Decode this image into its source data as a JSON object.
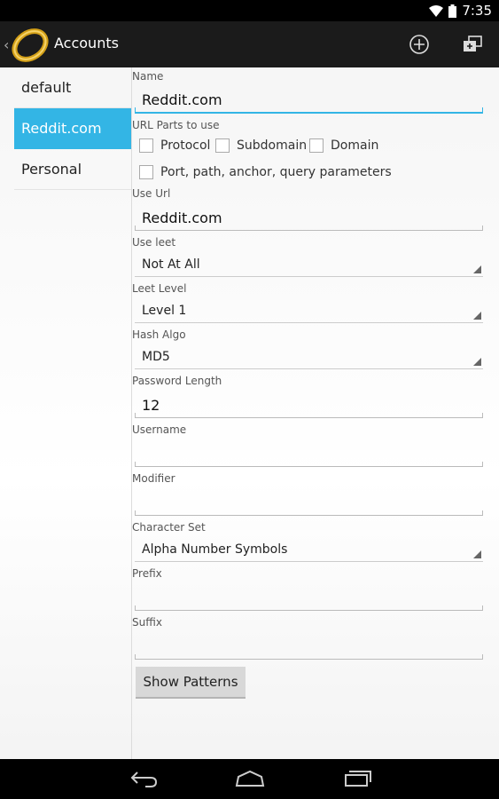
{
  "status_bar": {
    "time": "7:35"
  },
  "action_bar": {
    "title": "Accounts",
    "add_icon": "add-circle-icon",
    "copy_icon": "copy-account-icon"
  },
  "accounts": [
    {
      "label": "default",
      "selected": false
    },
    {
      "label": "Reddit.com",
      "selected": true
    },
    {
      "label": "Personal",
      "selected": false
    }
  ],
  "form": {
    "name": {
      "label": "Name",
      "value": "Reddit.com"
    },
    "url_parts": {
      "label": "URL Parts to use",
      "protocol": "Protocol",
      "subdomain": "Subdomain",
      "domain": "Domain",
      "port_path": "Port, path, anchor, query parameters"
    },
    "use_url": {
      "label": "Use Url",
      "value": "Reddit.com"
    },
    "use_leet": {
      "label": "Use leet",
      "value": "Not At All"
    },
    "leet_level": {
      "label": "Leet Level",
      "value": "Level 1"
    },
    "hash_algo": {
      "label": "Hash Algo",
      "value": "MD5"
    },
    "password_length": {
      "label": "Password Length",
      "value": "12"
    },
    "username": {
      "label": "Username",
      "value": ""
    },
    "modifier": {
      "label": "Modifier",
      "value": ""
    },
    "character_set": {
      "label": "Character Set",
      "value": "Alpha Number Symbols"
    },
    "prefix": {
      "label": "Prefix",
      "value": ""
    },
    "suffix": {
      "label": "Suffix",
      "value": ""
    },
    "show_patterns_label": "Show Patterns"
  },
  "colors": {
    "accent": "#33b5e5",
    "action_bar": "#1b1b1b",
    "status_bar": "#000000"
  }
}
